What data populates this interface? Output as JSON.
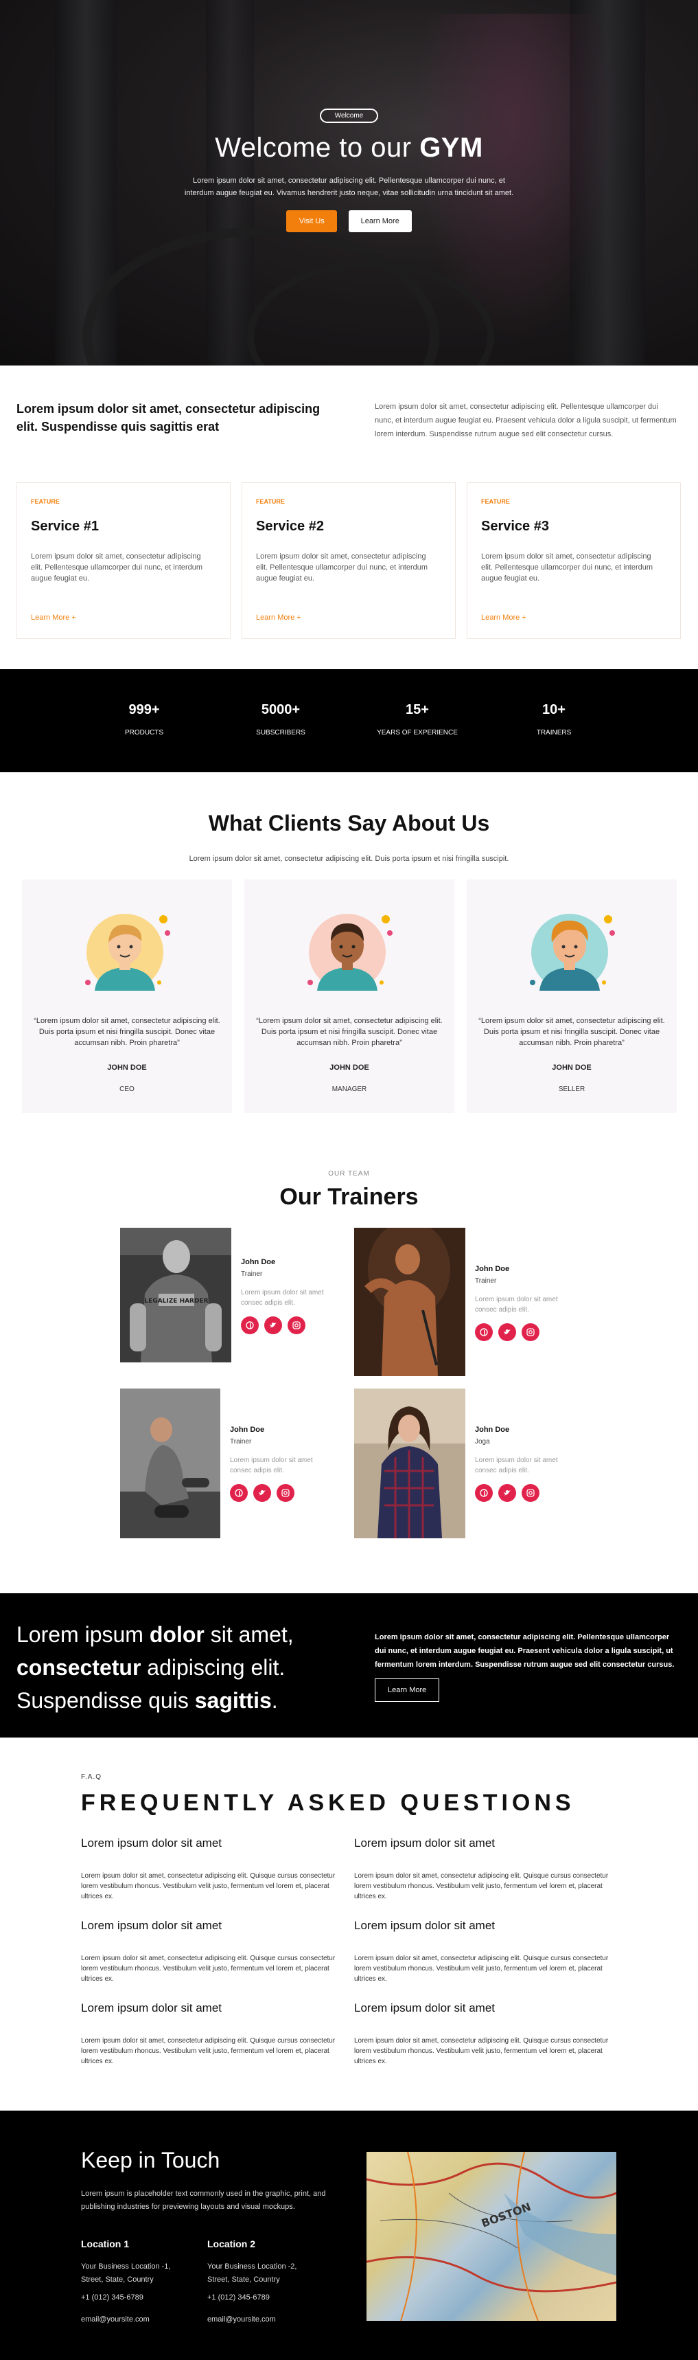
{
  "hero": {
    "tag": "Welcome",
    "title_pre": "Welcome to our ",
    "title_bold": "GYM",
    "text": "Lorem ipsum dolor sit amet, consectetur adipiscing elit. Pellentesque ullamcorper dui nunc, et interdum augue feugiat eu. Vivamus hendrerit justo neque, vitae sollicitudin urna tincidunt sit amet.",
    "btn_primary": "Visit Us",
    "btn_secondary": "Learn More"
  },
  "intro": {
    "heading": "Lorem ipsum dolor sit amet, consectetur adipiscing elit. Suspendisse quis sagittis erat",
    "text": "Lorem ipsum dolor sit amet, consectetur adipiscing elit. Pellentesque ullamcorper dui nunc, et interdum augue feugiat eu. Praesent vehicula dolor a ligula suscipit, ut fermentum lorem interdum. Suspendisse rutrum augue sed elit consectetur cursus."
  },
  "services": [
    {
      "tag": "FEATURE",
      "title": "Service #1",
      "text": "Lorem ipsum dolor sit amet, consectetur adipiscing elit. Pellentesque ullamcorper dui nunc, et interdum augue feugiat eu.",
      "link": "Learn More +"
    },
    {
      "tag": "FEATURE",
      "title": "Service #2",
      "text": "Lorem ipsum dolor sit amet, consectetur adipiscing elit. Pellentesque ullamcorper dui nunc, et interdum augue feugiat eu.",
      "link": "Learn More +"
    },
    {
      "tag": "FEATURE",
      "title": "Service #3",
      "text": "Lorem ipsum dolor sit amet, consectetur adipiscing elit. Pellentesque ullamcorper dui nunc, et interdum augue feugiat eu.",
      "link": "Learn More +"
    }
  ],
  "stats": [
    {
      "num": "999+",
      "label": "PRODUCTS"
    },
    {
      "num": "5000+",
      "label": "SUBSCRIBERS"
    },
    {
      "num": "15+",
      "label": "YEARS OF EXPERIENCE"
    },
    {
      "num": "10+",
      "label": "TRAINERS"
    }
  ],
  "testimonials": {
    "title": "What Clients Say About Us",
    "subtitle": "Lorem ipsum dolor sit amet, consectetur adipiscing elit. Duis porta ipsum et nisi fringilla suscipit.",
    "items": [
      {
        "quote": "“Lorem ipsum dolor sit amet, consectetur adipiscing elit. Duis porta ipsum et nisi fringilla suscipit. Donec vitae accumsan nibh. Proin pharetra”",
        "name": "JOHN DOE",
        "role": "CEO",
        "bg": "#fbd98a",
        "skin": "#f6c9a1",
        "hair": "#e0a04a",
        "shirt": "#3aa6a6"
      },
      {
        "quote": "“Lorem ipsum dolor sit amet, consectetur adipiscing elit. Duis porta ipsum et nisi fringilla suscipit. Donec vitae accumsan nibh. Proin pharetra”",
        "name": "JOHN DOE",
        "role": "MANAGER",
        "bg": "#f9cfc3",
        "skin": "#a8673e",
        "hair": "#3b2416",
        "shirt": "#3aa6a6"
      },
      {
        "quote": "“Lorem ipsum dolor sit amet, consectetur adipiscing elit. Duis porta ipsum et nisi fringilla suscipit. Donec vitae accumsan nibh. Proin pharetra”",
        "name": "JOHN DOE",
        "role": "SELLER",
        "bg": "#9fdada",
        "skin": "#f2b58a",
        "hair": "#e38b23",
        "shirt": "#2f7f95"
      }
    ]
  },
  "trainers": {
    "eyebrow": "OUR TEAM",
    "title": "Our Trainers",
    "items": [
      {
        "name": "John Doe",
        "role": "Trainer",
        "desc": "Lorem ipsum dolor sit amet consec adipis elit."
      },
      {
        "name": "John Doe",
        "role": "Trainer",
        "desc": "Lorem ipsum dolor sit amet consec adipis elit."
      },
      {
        "name": "John Doe",
        "role": "Trainer",
        "desc": "Lorem ipsum dolor sit amet consec adipis elit."
      },
      {
        "name": "John Doe",
        "role": "Joga",
        "desc": "Lorem ipsum dolor sit amet consec adipis elit."
      }
    ],
    "shirt_text": "LEGALIZE HARDER"
  },
  "banner": {
    "t1": "Lorem ipsum ",
    "b1": "dolor",
    "t2": " sit amet,",
    "b2": "consectetur",
    "t3": " adipiscing elit.",
    "t4": "Suspendisse quis ",
    "b3": "sagittis",
    "t5": ".",
    "text": "Lorem ipsum dolor sit amet, consectetur adipiscing elit. Pellentesque ullamcorper dui nunc, et interdum augue feugiat eu. Praesent vehicula dolor a ligula suscipit, ut fermentum lorem interdum. Suspendisse rutrum augue sed elit consectetur cursus.",
    "button": "Learn More"
  },
  "faq": {
    "eyebrow": "F.A.Q",
    "title": "FREQUENTLY ASKED QUESTIONS",
    "items": [
      {
        "q": "Lorem ipsum dolor sit amet",
        "a": "Lorem ipsum dolor sit amet, consectetur adipiscing elit. Quisque cursus consectetur lorem vestibulum rhoncus. Vestibulum velit justo, fermentum vel lorem et, placerat ultrices ex."
      },
      {
        "q": "Lorem ipsum dolor sit amet",
        "a": "Lorem ipsum dolor sit amet, consectetur adipiscing elit. Quisque cursus consectetur lorem vestibulum rhoncus. Vestibulum velit justo, fermentum vel lorem et, placerat ultrices ex."
      },
      {
        "q": "Lorem ipsum dolor sit amet",
        "a": "Lorem ipsum dolor sit amet, consectetur adipiscing elit. Quisque cursus consectetur lorem vestibulum rhoncus. Vestibulum velit justo, fermentum vel lorem et, placerat ultrices ex."
      },
      {
        "q": "Lorem ipsum dolor sit amet",
        "a": "Lorem ipsum dolor sit amet, consectetur adipiscing elit. Quisque cursus consectetur lorem vestibulum rhoncus. Vestibulum velit justo, fermentum vel lorem et, placerat ultrices ex."
      },
      {
        "q": "Lorem ipsum dolor sit amet",
        "a": "Lorem ipsum dolor sit amet, consectetur adipiscing elit. Quisque cursus consectetur lorem vestibulum rhoncus. Vestibulum velit justo, fermentum vel lorem et, placerat ultrices ex."
      },
      {
        "q": "Lorem ipsum dolor sit amet",
        "a": "Lorem ipsum dolor sit amet, consectetur adipiscing elit. Quisque cursus consectetur lorem vestibulum rhoncus. Vestibulum velit justo, fermentum vel lorem et, placerat ultrices ex."
      }
    ]
  },
  "footer": {
    "title": "Keep in Touch",
    "desc": "Lorem ipsum is placeholder text commonly used in the graphic, print, and publishing industries for previewing layouts and visual mockups.",
    "map_label": "BOSTON",
    "locations": [
      {
        "title": "Location 1",
        "line1": "Your Business Location -1,",
        "line2": "Street, State, Country",
        "phone": "+1 (012) 345-6789",
        "email": "email@yoursite.com"
      },
      {
        "title": "Location 2",
        "line1": "Your Business Location -2,",
        "line2": "Street, State, Country",
        "phone": "+1 (012) 345-6789",
        "email": "email@yoursite.com"
      }
    ]
  },
  "colors": {
    "accent": "#f27f0c",
    "social": "#e1234c",
    "dark": "#000000"
  },
  "icons": [
    "facebook-icon",
    "twitter-icon",
    "instagram-icon"
  ]
}
